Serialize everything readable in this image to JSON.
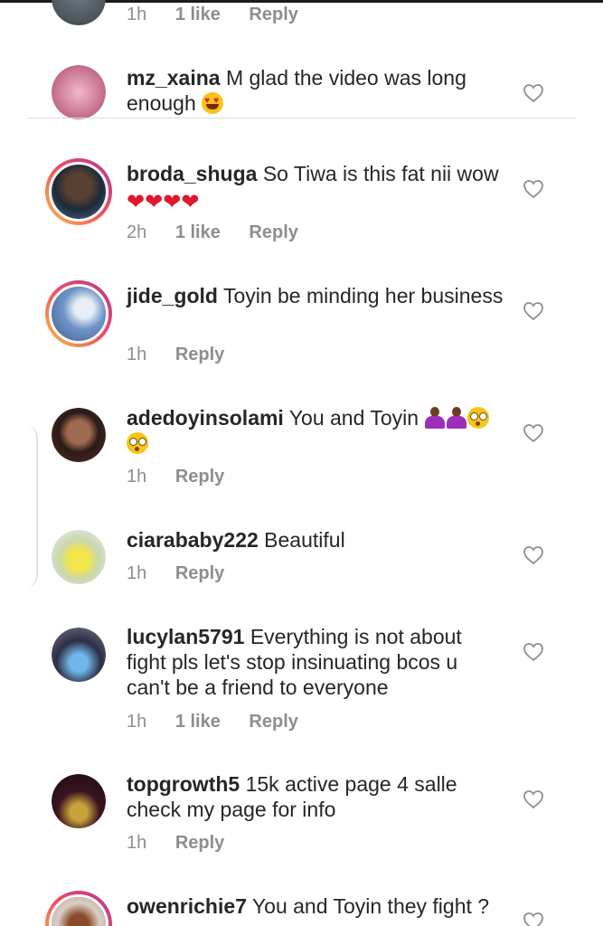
{
  "colors": {
    "text": "#262626",
    "meta": "#8e8e8e",
    "heart_emoji": "#e0182d",
    "story_ring": [
      "#f9c544",
      "#ee4f61",
      "#b8368f"
    ]
  },
  "icons": {
    "like": "heart-outline-icon"
  },
  "partial_top": {
    "time": "1h",
    "likes": "1 like",
    "reply": "Reply"
  },
  "comments": [
    {
      "username": "mz_xaina",
      "text_before": "M glad the video was long enough",
      "emoji": [
        "smiling-face-heart-eyes"
      ],
      "time": "",
      "likes": "",
      "reply": ""
    },
    {
      "username": "broda_shuga",
      "text_before": "So Tiwa is this fat nii wow",
      "emoji": [
        "red-heart",
        "red-heart",
        "red-heart",
        "red-heart"
      ],
      "time": "2h",
      "likes": "1 like",
      "reply": "Reply"
    },
    {
      "username": "jide_gold",
      "text_before": "Toyin be minding her business",
      "emoji": [],
      "time": "1h",
      "likes": "",
      "reply": "Reply"
    },
    {
      "username": "adedoyinsolami",
      "text_before": "You and Toyin",
      "emoji": [
        "woman-shrugging",
        "woman-shrugging",
        "flushed-face",
        "flushed-face"
      ],
      "time": "1h",
      "likes": "",
      "reply": "Reply"
    },
    {
      "username": "ciarababy222",
      "text_before": "Beautiful",
      "emoji": [],
      "time": "1h",
      "likes": "",
      "reply": "Reply"
    },
    {
      "username": "lucylan5791",
      "text_before": "Everything is not about fight pls let's stop insinuating bcos u can't be a friend to everyone",
      "emoji": [],
      "time": "1h",
      "likes": "1 like",
      "reply": "Reply"
    },
    {
      "username": "topgrowth5",
      "text_before": "15k active page 4 salle check my page for info",
      "emoji": [],
      "time": "1h",
      "likes": "",
      "reply": "Reply"
    },
    {
      "username": "owenrichie7",
      "text_before": "You and Toyin they fight ?",
      "emoji": [],
      "time": "",
      "likes": "",
      "reply": ""
    }
  ]
}
